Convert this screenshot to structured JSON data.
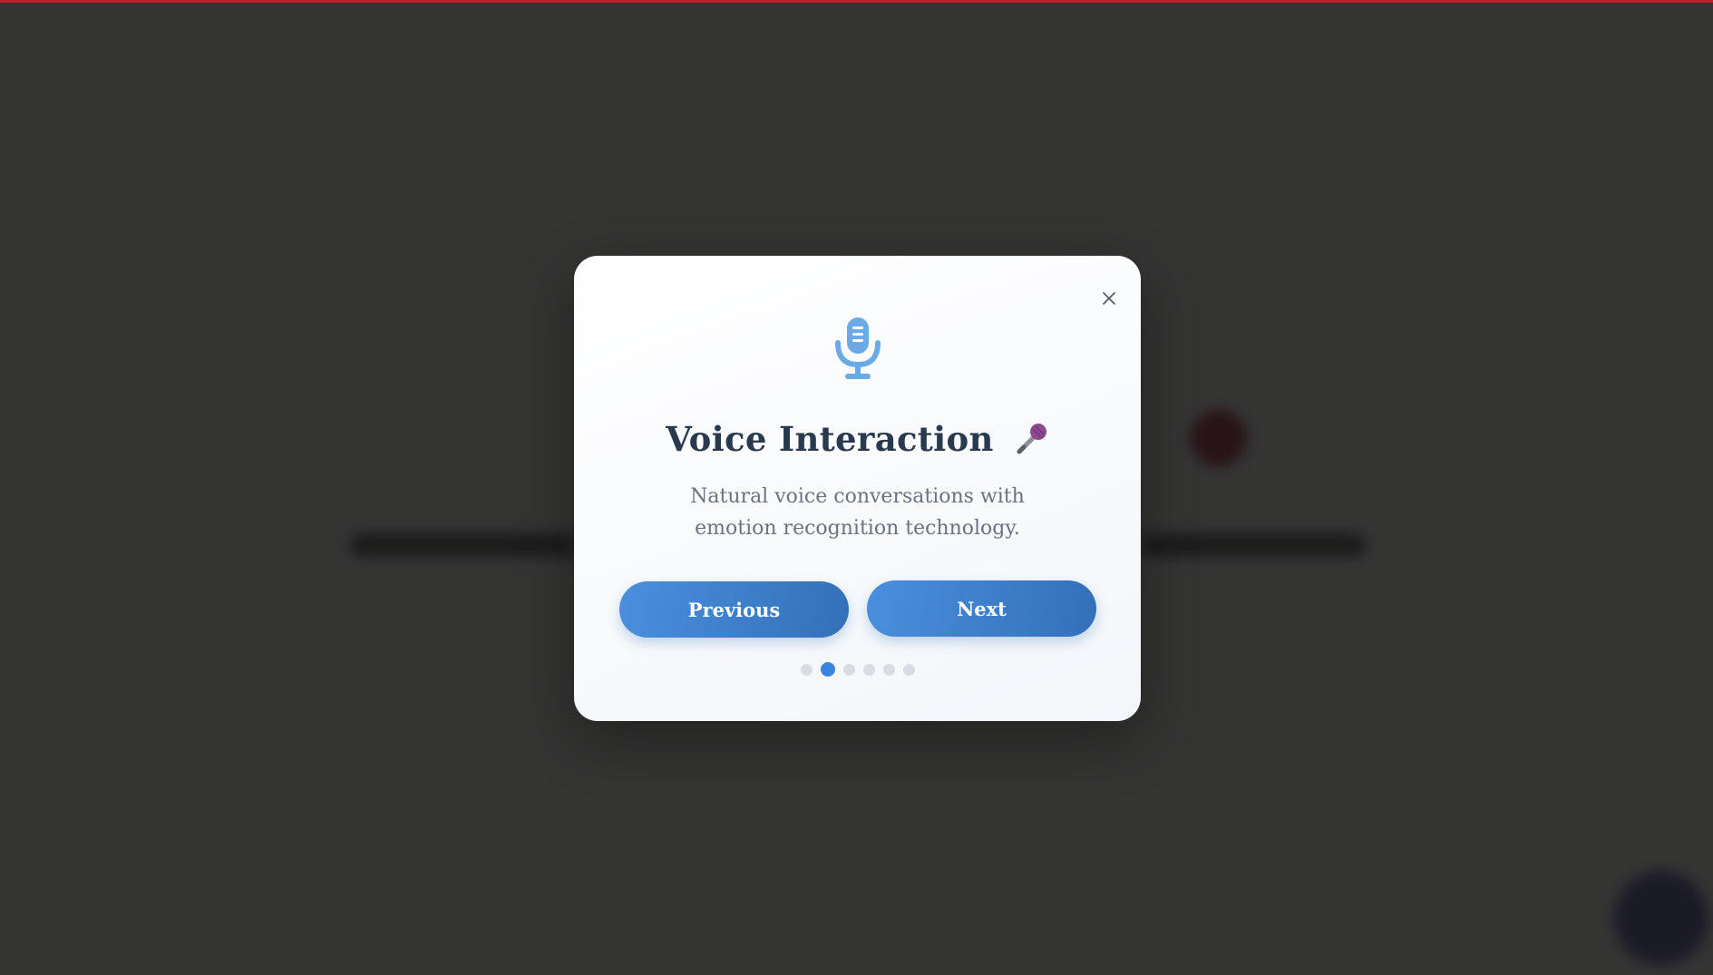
{
  "background": {
    "accent_color": "#c0202c"
  },
  "modal": {
    "title": "Voice Interaction",
    "title_emoji": "microphone-emoji",
    "icon": "microphone-icon",
    "description": "Natural voice conversations with emotion recognition technology.",
    "close_label": "×",
    "buttons": {
      "previous": "Previous",
      "next": "Next"
    },
    "steps": {
      "total": 6,
      "current": 2
    },
    "colors": {
      "primary": "#3a86de",
      "title": "#2a3a4e",
      "text": "#6b7280"
    }
  }
}
